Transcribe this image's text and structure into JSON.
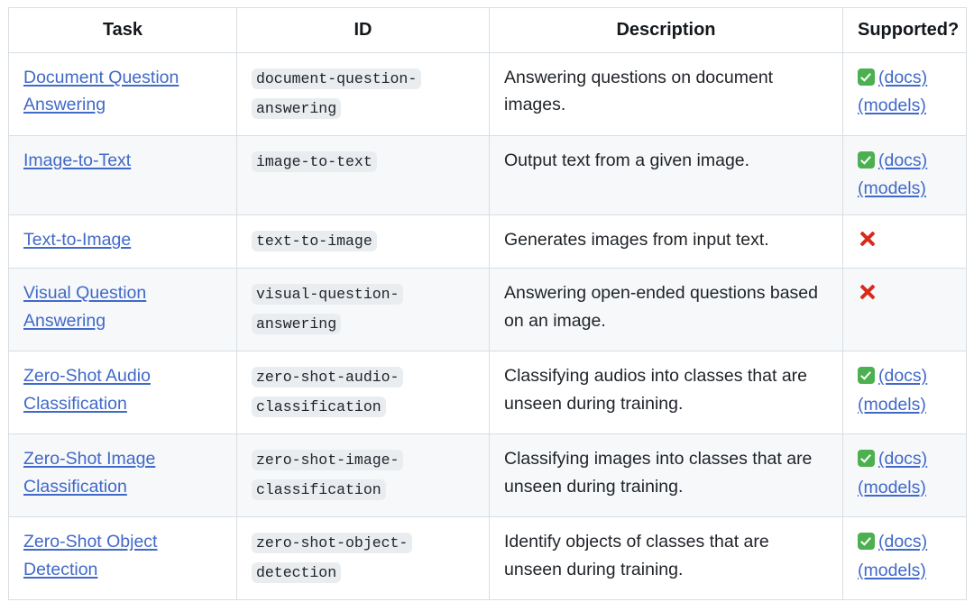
{
  "table": {
    "columns": [
      {
        "key": "task",
        "label": "Task"
      },
      {
        "key": "id",
        "label": "ID"
      },
      {
        "key": "description",
        "label": "Description"
      },
      {
        "key": "supported",
        "label": "Supported?"
      }
    ],
    "link_labels": {
      "docs": "(docs)",
      "models": "(models)"
    },
    "icons": {
      "supported": "white-check-mark-icon",
      "not_supported": "cross-mark-icon"
    },
    "colors": {
      "link": "#4169c8",
      "check_green": "#4cb050",
      "cross_red": "#d92b1c",
      "row_stripe": "#f6f8fa",
      "border": "#d8dee4",
      "code_chip_bg": "#eaedf0"
    },
    "rows": [
      {
        "task": "Document Question Answering",
        "id": "document-question-answering",
        "description": "Answering questions on document images.",
        "supported": true
      },
      {
        "task": "Image-to-Text",
        "id": "image-to-text",
        "description": "Output text from a given image.",
        "supported": true
      },
      {
        "task": "Text-to-Image",
        "id": "text-to-image",
        "description": "Generates images from input text.",
        "supported": false
      },
      {
        "task": "Visual Question Answering",
        "id": "visual-question-answering",
        "description": "Answering open-ended questions based on an image.",
        "supported": false
      },
      {
        "task": "Zero-Shot Audio Classification",
        "id": "zero-shot-audio-classification",
        "description": "Classifying audios into classes that are unseen during training.",
        "supported": true
      },
      {
        "task": "Zero-Shot Image Classification",
        "id": "zero-shot-image-classification",
        "description": "Classifying images into classes that are unseen during training.",
        "supported": true
      },
      {
        "task": "Zero-Shot Object Detection",
        "id": "zero-shot-object-detection",
        "description": "Identify objects of classes that are unseen during training.",
        "supported": true
      }
    ]
  }
}
